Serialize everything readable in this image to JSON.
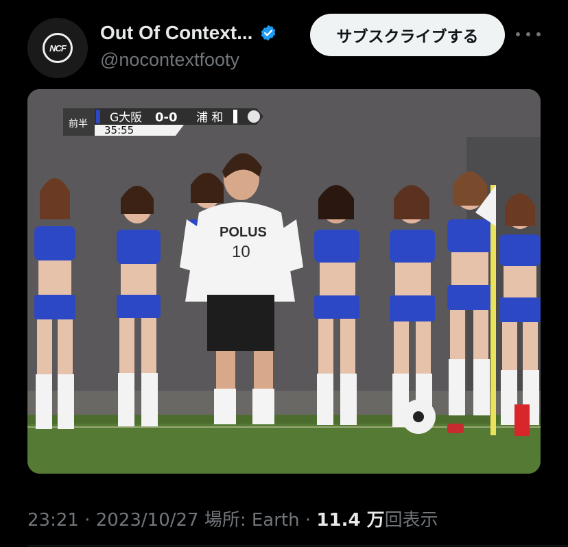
{
  "tweet": {
    "author": {
      "display_name": "Out Of Context...",
      "handle": "@nocontextfooty",
      "avatar_text": "NCF",
      "verified": true
    },
    "subscribe_label": "サブスクライブする",
    "more_icon": "more-horizontal-icon",
    "media": {
      "scorebug": {
        "period": "前半",
        "home_team": "G大阪",
        "score": "0-0",
        "away_team": "浦 和",
        "clock": "35:55"
      },
      "shirt": {
        "sponsor": "POLUS",
        "number": "10"
      }
    },
    "meta": {
      "time": "23:21",
      "date": "2023/10/27",
      "location_label": "場所: Earth",
      "views_count": "11.4 万",
      "views_label": "回表示",
      "separator": "·"
    }
  },
  "colors": {
    "background": "#000000",
    "text_primary": "#e7e9ea",
    "text_secondary": "#71767b",
    "verified_blue": "#1d9bf0",
    "subscribe_bg": "#eff3f4",
    "uniform_blue": "#2c48c4"
  }
}
